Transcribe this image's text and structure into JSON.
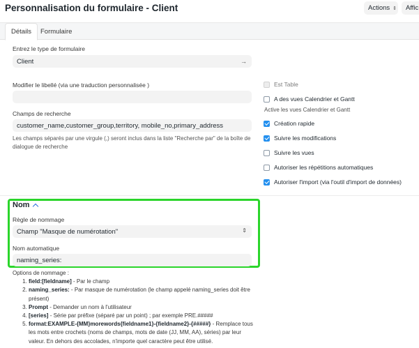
{
  "header": {
    "title": "Personnalisation du formulaire - Client",
    "actions_label": "Actions",
    "display_label": "Affic"
  },
  "tabs": [
    {
      "label": "Détails",
      "active": true
    },
    {
      "label": "Formulaire",
      "active": false
    }
  ],
  "left": {
    "form_type": {
      "label": "Entrez le type de formulaire",
      "value": "Client"
    },
    "label_field": {
      "label": "Modifier le libellé (via une traduction personnalisée )",
      "value": ""
    },
    "search_fields": {
      "label": "Champs de recherche",
      "value": "customer_name,customer_group,territory, mobile_no,primary_address",
      "help": "Les champs séparés par une virgule (,) seront inclus dans la liste \"Recherche par\" de la boîte de dialogue de recherche"
    }
  },
  "right": {
    "is_table": {
      "label": "Est Table",
      "checked": false,
      "disabled": true
    },
    "calendar_gantt": {
      "label": "A des vues Calendrier et Gantt",
      "checked": false
    },
    "calendar_gantt_help": "Active les vues Calendrier et Gantt",
    "quick_entry": {
      "label": "Création rapide",
      "checked": true
    },
    "track_changes": {
      "label": "Suivre les modifications",
      "checked": true
    },
    "track_views": {
      "label": "Suivre les vues",
      "checked": false
    },
    "auto_repeat": {
      "label": "Autoriser les répétitions automatiques",
      "checked": false
    },
    "allow_import": {
      "label": "Autoriser l'import (via l'outil d'import de données)",
      "checked": true
    }
  },
  "naming": {
    "section_title": "Nom",
    "rule_label": "Règle de nommage",
    "rule_value": "Champ \"Masque de numérotation\"",
    "autoname_label": "Nom automatique",
    "autoname_value": "naming_series:",
    "options_title": "Options de nommage :",
    "options": [
      {
        "bold": "field:[fieldname]",
        "text": " - Par le champ"
      },
      {
        "bold": "naming_series:",
        "text": " - Par masque de numérotation (le champ appelé naming_series doit être présent)"
      },
      {
        "bold": "Prompt",
        "text": " - Demander un nom à l'utilisateur"
      },
      {
        "bold": "[series]",
        "text": " - Série par préfixe (séparé par un point) ; par exemple PRE.#####"
      },
      {
        "bold": "format:EXAMPLE-{MM}morewords{fieldname1}-{fieldname2}-{#####}",
        "text": " - Remplace tous les mots entre crochets (noms de champs, mots de date (JJ, MM, AA), séries) par leur valeur. En dehors des accolades, n'importe quel caractère peut être utilisé."
      }
    ]
  },
  "colors": {
    "highlight_border": "#2bd52b",
    "checkbox_checked": "#2490ef",
    "input_bg": "#f3f3f3"
  }
}
